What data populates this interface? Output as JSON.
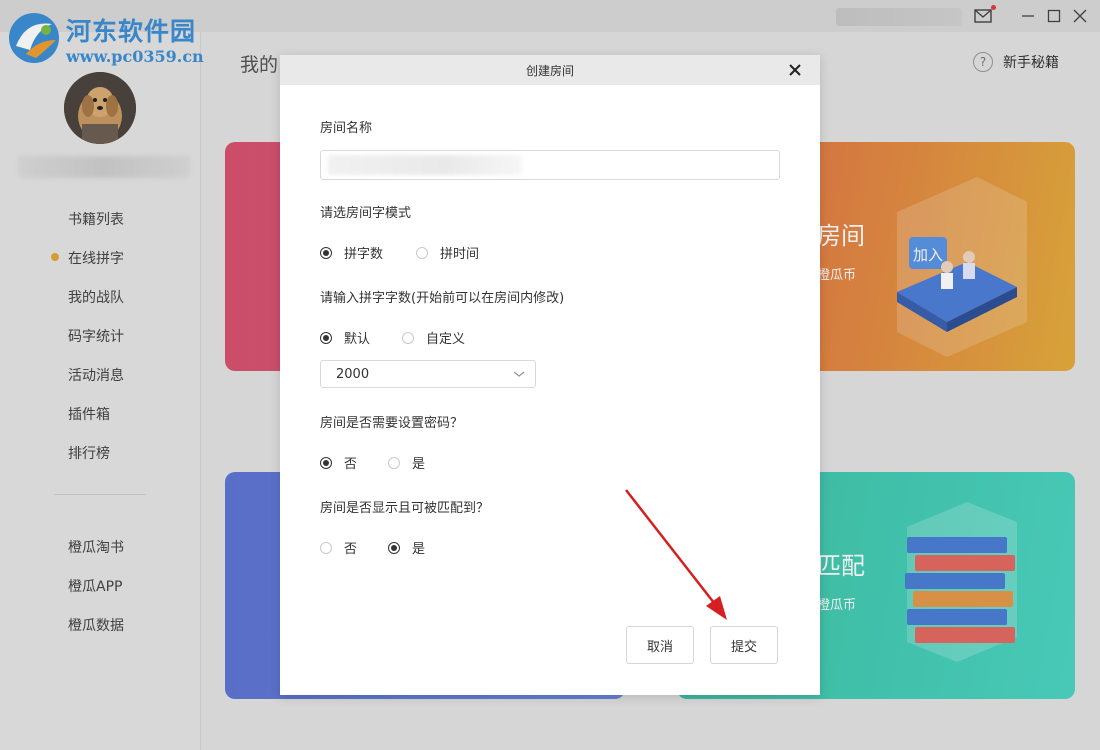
{
  "watermark": {
    "title": "河东软件园",
    "url": "www.pc0359.cn"
  },
  "titlebar": {
    "icons": [
      "mail-icon",
      "minimize-icon",
      "maximize-icon",
      "close-icon"
    ]
  },
  "sidebar": {
    "items": [
      {
        "label": "书籍列表"
      },
      {
        "label": "在线拼字",
        "active": true
      },
      {
        "label": "我的战队"
      },
      {
        "label": "码字统计"
      },
      {
        "label": "活动消息"
      },
      {
        "label": "插件箱"
      },
      {
        "label": "排行榜"
      }
    ],
    "extra_items": [
      {
        "label": "橙瓜淘书"
      },
      {
        "label": "橙瓜APP"
      },
      {
        "label": "橙瓜数据"
      }
    ]
  },
  "main": {
    "title": "我的",
    "help_label": "新手秘籍",
    "cards": [
      {
        "title": "房间",
        "subtitle": "橙瓜币"
      },
      {
        "title": "匹配",
        "subtitle": "橙瓜币"
      }
    ],
    "badge": "加入"
  },
  "modal": {
    "title": "创建房间",
    "room_name_label": "房间名称",
    "room_name_value": "",
    "mode_label": "请选房间字模式",
    "mode_options": [
      {
        "label": "拼字数",
        "checked": true
      },
      {
        "label": "拼时间",
        "checked": false
      }
    ],
    "count_label": "请输入拼字字数(开始前可以在房间内修改)",
    "count_options": [
      {
        "label": "默认",
        "checked": true
      },
      {
        "label": "自定义",
        "checked": false
      }
    ],
    "count_select_value": "2000",
    "password_label": "房间是否需要设置密码？",
    "password_options": [
      {
        "label": "否",
        "checked": true
      },
      {
        "label": "是",
        "checked": false
      }
    ],
    "visible_label": "房间是否显示且可被匹配到？",
    "visible_options": [
      {
        "label": "否",
        "checked": false
      },
      {
        "label": "是",
        "checked": true
      }
    ],
    "cancel_label": "取消",
    "submit_label": "提交"
  },
  "colors": {
    "accent_dot": "#e0a838",
    "annotation_arrow": "#d42020",
    "card_pink": "#d8526f",
    "card_orange": "#e38a43",
    "card_blue": "#6a89e3",
    "card_teal": "#45cdb4"
  }
}
